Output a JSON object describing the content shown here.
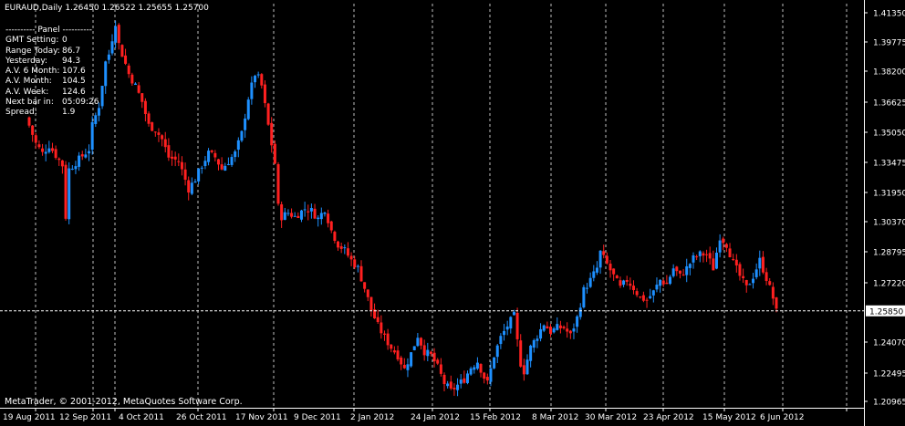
{
  "header": {
    "symbol": "EURAUD,Daily",
    "open": "1.26450",
    "high": "1.26522",
    "low": "1.25655",
    "close": "1.25700"
  },
  "panel": {
    "title": "---------- Panel ----------",
    "rows": [
      {
        "label": "GMT Setting:",
        "value": "0"
      },
      {
        "label": "Range Today:",
        "value": "86.7"
      },
      {
        "label": "Yesterday:",
        "value": "94.3"
      },
      {
        "label": "A.V. 6 Month:",
        "value": "107.6"
      },
      {
        "label": "A.V. Month:",
        "value": "104.5"
      },
      {
        "label": "A.V. Week:",
        "value": "124.6"
      },
      {
        "label": "Next bar in:",
        "value": "05:09:26"
      },
      {
        "label": "Spread:",
        "value": "1.9"
      }
    ]
  },
  "copyright": "MetaTrader, © 2001-2012, MetaQuotes Software Corp.",
  "colors": {
    "background": "#000000",
    "bull": "#1E90FF",
    "bear": "#FF2020",
    "grid": "#C0C0C0",
    "text": "#FFFFFF"
  },
  "chart_data": {
    "type": "candlestick",
    "symbol": "EURAUD",
    "timeframe": "Daily",
    "ylim": [
      1.2096,
      1.4135
    ],
    "y_ticks": [
      "1.41350",
      "1.39775",
      "1.38200",
      "1.36625",
      "1.35050",
      "1.33475",
      "1.31950",
      "1.30370",
      "1.28795",
      "1.27220",
      "1.24070",
      "1.22495",
      "1.20965"
    ],
    "current_price": "1.25850",
    "x_labels": [
      "19 Aug 2011",
      "12 Sep 2011",
      "4 Oct 2011",
      "26 Oct 2011",
      "17 Nov 2011",
      "9 Dec 2011",
      "2 Jan 2012",
      "24 Jan 2012",
      "15 Feb 2012",
      "8 Mar 2012",
      "30 Mar 2012",
      "23 Apr 2012",
      "15 May 2012",
      "6 Jun 2012"
    ],
    "anchors": [
      [
        0,
        1.352
      ],
      [
        2,
        1.343
      ],
      [
        4,
        1.338
      ],
      [
        6,
        1.342
      ],
      [
        10,
        1.332
      ],
      [
        11,
        1.306
      ],
      [
        12,
        1.33
      ],
      [
        15,
        1.335
      ],
      [
        18,
        1.34
      ],
      [
        19,
        1.352
      ],
      [
        21,
        1.362
      ],
      [
        23,
        1.384
      ],
      [
        24,
        1.388
      ],
      [
        26,
        1.404
      ],
      [
        27,
        1.393
      ],
      [
        28,
        1.388
      ],
      [
        30,
        1.378
      ],
      [
        32,
        1.372
      ],
      [
        34,
        1.364
      ],
      [
        36,
        1.352
      ],
      [
        38,
        1.35
      ],
      [
        40,
        1.345
      ],
      [
        42,
        1.336
      ],
      [
        45,
        1.334
      ],
      [
        48,
        1.32
      ],
      [
        50,
        1.325
      ],
      [
        52,
        1.332
      ],
      [
        54,
        1.338
      ],
      [
        56,
        1.336
      ],
      [
        58,
        1.33
      ],
      [
        60,
        1.334
      ],
      [
        62,
        1.338
      ],
      [
        64,
        1.348
      ],
      [
        66,
        1.366
      ],
      [
        68,
        1.378
      ],
      [
        69,
        1.376
      ],
      [
        70,
        1.372
      ],
      [
        72,
        1.352
      ],
      [
        74,
        1.333
      ],
      [
        75,
        1.311
      ],
      [
        76,
        1.306
      ],
      [
        78,
        1.308
      ],
      [
        80,
        1.306
      ],
      [
        83,
        1.31
      ],
      [
        85,
        1.309
      ],
      [
        87,
        1.305
      ],
      [
        89,
        1.31
      ],
      [
        91,
        1.299
      ],
      [
        93,
        1.292
      ],
      [
        95,
        1.289
      ],
      [
        97,
        1.284
      ],
      [
        99,
        1.28
      ],
      [
        101,
        1.27
      ],
      [
        103,
        1.259
      ],
      [
        105,
        1.251
      ],
      [
        107,
        1.245
      ],
      [
        109,
        1.24
      ],
      [
        111,
        1.236
      ],
      [
        113,
        1.229
      ],
      [
        115,
        1.237
      ],
      [
        117,
        1.246
      ],
      [
        119,
        1.238
      ],
      [
        121,
        1.236
      ],
      [
        123,
        1.23
      ],
      [
        125,
        1.222
      ],
      [
        127,
        1.218
      ],
      [
        129,
        1.221
      ],
      [
        131,
        1.224
      ],
      [
        133,
        1.23
      ],
      [
        135,
        1.233
      ],
      [
        137,
        1.225
      ],
      [
        138,
        1.222
      ],
      [
        140,
        1.236
      ],
      [
        142,
        1.245
      ],
      [
        144,
        1.251
      ],
      [
        146,
        1.256
      ],
      [
        147,
        1.243
      ],
      [
        148,
        1.232
      ],
      [
        149,
        1.228
      ],
      [
        151,
        1.24
      ],
      [
        153,
        1.246
      ],
      [
        155,
        1.252
      ],
      [
        157,
        1.248
      ],
      [
        159,
        1.25
      ],
      [
        161,
        1.25
      ],
      [
        163,
        1.246
      ],
      [
        165,
        1.255
      ],
      [
        167,
        1.269
      ],
      [
        169,
        1.274
      ],
      [
        171,
        1.28
      ],
      [
        172,
        1.288
      ],
      [
        174,
        1.282
      ],
      [
        176,
        1.276
      ],
      [
        178,
        1.27
      ],
      [
        180,
        1.274
      ],
      [
        182,
        1.27
      ],
      [
        184,
        1.265
      ],
      [
        186,
        1.264
      ],
      [
        188,
        1.268
      ],
      [
        190,
        1.274
      ],
      [
        192,
        1.272
      ],
      [
        194,
        1.28
      ],
      [
        196,
        1.276
      ],
      [
        198,
        1.28
      ],
      [
        200,
        1.285
      ],
      [
        202,
        1.287
      ],
      [
        204,
        1.287
      ],
      [
        206,
        1.28
      ],
      [
        208,
        1.296
      ],
      [
        210,
        1.292
      ],
      [
        212,
        1.283
      ],
      [
        214,
        1.276
      ],
      [
        216,
        1.27
      ],
      [
        218,
        1.276
      ],
      [
        220,
        1.284
      ],
      [
        222,
        1.275
      ],
      [
        224,
        1.265
      ],
      [
        225,
        1.258
      ]
    ]
  }
}
